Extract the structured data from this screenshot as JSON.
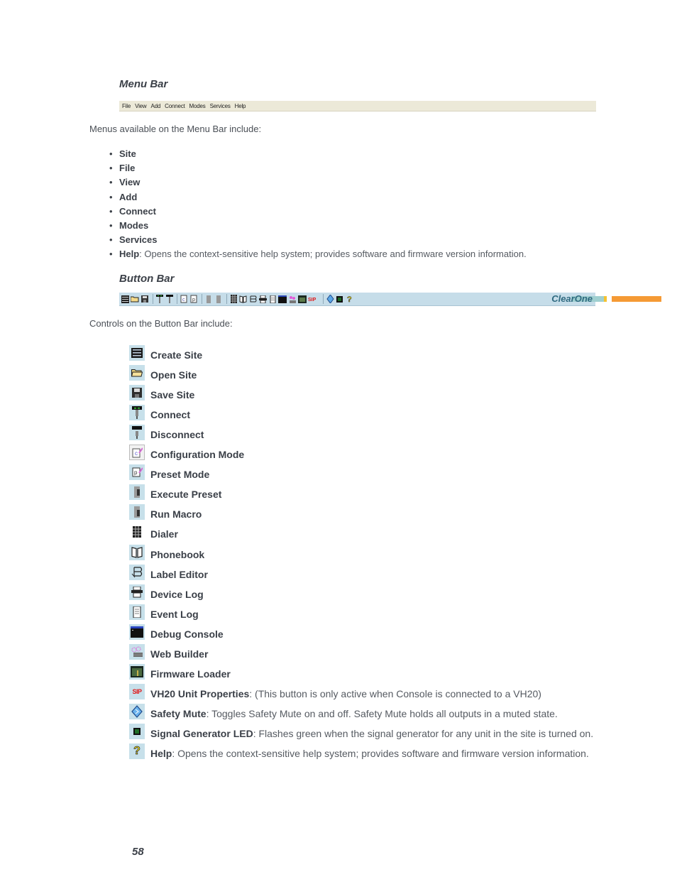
{
  "sections": {
    "menu_bar_heading": "Menu Bar",
    "button_bar_heading": "Button Bar"
  },
  "menubar_screenshot": {
    "items": [
      "File",
      "View",
      "Add",
      "Connect",
      "Modes",
      "Services",
      "Help"
    ]
  },
  "menus_intro": "Menus available on the Menu Bar include:",
  "menus": [
    {
      "name": "Site",
      "desc": ""
    },
    {
      "name": "File",
      "desc": ""
    },
    {
      "name": "View",
      "desc": ""
    },
    {
      "name": "Add",
      "desc": ""
    },
    {
      "name": "Connect",
      "desc": ""
    },
    {
      "name": "Modes",
      "desc": ""
    },
    {
      "name": "Services",
      "desc": ""
    },
    {
      "name": "Help",
      "desc": ": Opens the context-sensitive help system; provides software and firmware version information."
    }
  ],
  "buttonbar_screenshot": {
    "logo": "ClearOne",
    "colors": {
      "background": "#c6dde9",
      "bar_teal": "#9fcfd0",
      "bar_orange": "#f59a35",
      "logo": "#2f6a80"
    }
  },
  "controls_intro": "Controls on the Button Bar include:",
  "controls": [
    {
      "icon": "create-site-icon",
      "name": "Create Site",
      "desc": ""
    },
    {
      "icon": "open-site-icon",
      "name": "Open Site",
      "desc": ""
    },
    {
      "icon": "save-site-icon",
      "name": "Save Site",
      "desc": ""
    },
    {
      "icon": "connect-icon",
      "name": "Connect",
      "desc": ""
    },
    {
      "icon": "disconnect-icon",
      "name": "Disconnect",
      "desc": ""
    },
    {
      "icon": "configuration-mode-icon",
      "name": "Configuration Mode",
      "desc": ""
    },
    {
      "icon": "preset-mode-icon",
      "name": "Preset Mode",
      "desc": ""
    },
    {
      "icon": "execute-preset-icon",
      "name": "Execute Preset",
      "desc": ""
    },
    {
      "icon": "run-macro-icon",
      "name": "Run Macro",
      "desc": ""
    },
    {
      "icon": "dialer-icon",
      "name": "Dialer",
      "desc": ""
    },
    {
      "icon": "phonebook-icon",
      "name": "Phonebook",
      "desc": ""
    },
    {
      "icon": "label-editor-icon",
      "name": "Label Editor",
      "desc": ""
    },
    {
      "icon": "device-log-icon",
      "name": "Device Log",
      "desc": ""
    },
    {
      "icon": "event-log-icon",
      "name": "Event Log",
      "desc": ""
    },
    {
      "icon": "debug-console-icon",
      "name": "Debug Console",
      "desc": ""
    },
    {
      "icon": "web-builder-icon",
      "name": "Web Builder",
      "desc": ""
    },
    {
      "icon": "firmware-loader-icon",
      "name": "Firmware Loader",
      "desc": ""
    },
    {
      "icon": "sip-icon",
      "name": "VH20 Unit Properties",
      "desc": ": (This button is only active when Console is connected to a VH20)"
    },
    {
      "icon": "safety-mute-icon",
      "name": "Safety Mute",
      "desc": ": Toggles Safety Mute on and off. Safety Mute holds all outputs in a muted state."
    },
    {
      "icon": "signal-generator-led-icon",
      "name": "Signal Generator LED",
      "desc": ": Flashes green when the signal generator for any unit in the site is turned on."
    },
    {
      "icon": "help-icon",
      "name": "Help",
      "desc": ": Opens the context-sensitive help system; provides software and firmware version information."
    }
  ],
  "icon_glyphs": {
    "sip_label": "SIP",
    "help_glyph": "?"
  },
  "page_number": "58"
}
